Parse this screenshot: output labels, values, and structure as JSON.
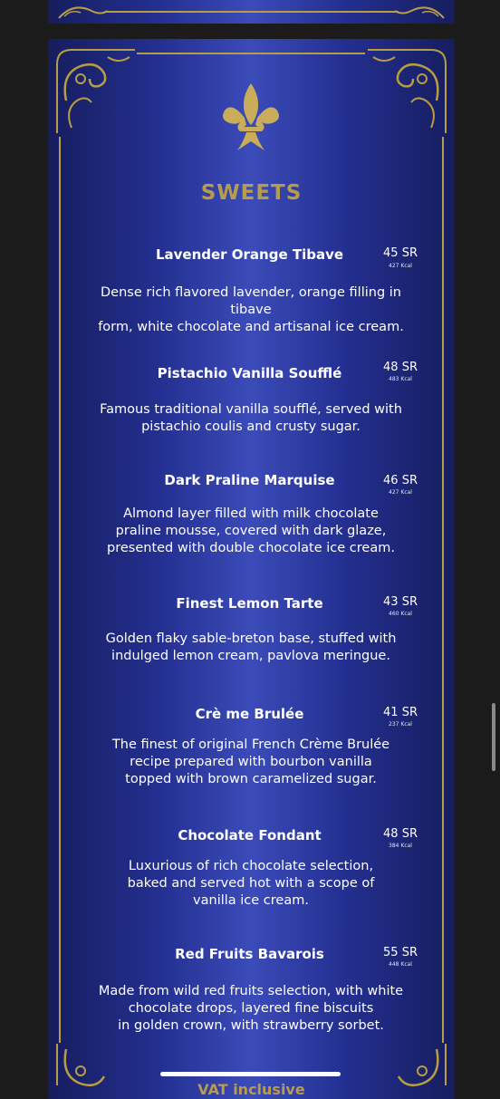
{
  "menu": {
    "section_title": "SWEETS",
    "items": [
      {
        "name": "Lavender Orange Tibave",
        "price": "45 SR",
        "kcal": "427 Kcal",
        "desc": [
          "Dense rich flavored lavender, orange filling in tibave",
          "form, white chocolate and artisanal ice cream."
        ]
      },
      {
        "name": "Pistachio Vanilla Soufflé",
        "price": "48 SR",
        "kcal": "483 Kcal",
        "desc": [
          "Famous traditional vanilla soufflé, served with",
          "pistachio coulis and crusty sugar."
        ]
      },
      {
        "name": "Dark Praline Marquise",
        "price": "46 SR",
        "kcal": "427 Kcal",
        "desc": [
          "Almond layer filled with milk chocolate",
          "praline mousse, covered with dark glaze,",
          "presented with double chocolate ice cream."
        ]
      },
      {
        "name": "Finest Lemon Tarte",
        "price": "43 SR",
        "kcal": "460 Kcal",
        "desc": [
          "Golden flaky sable-breton base, stuffed with",
          "indulged lemon cream, pavlova meringue."
        ]
      },
      {
        "name": "Crè me Brulée",
        "price": "41 SR",
        "kcal": "237 Kcal",
        "desc": [
          "The finest of original French Crème Brulée",
          "recipe prepared with bourbon vanilla",
          "topped with brown caramelized sugar."
        ]
      },
      {
        "name": "Chocolate Fondant",
        "price": "48 SR",
        "kcal": "384 Kcal",
        "desc": [
          "Luxurious of rich chocolate selection,",
          "baked and served hot with a scope of",
          "vanilla ice cream."
        ]
      },
      {
        "name": "Red Fruits Bavarois",
        "price": "55 SR",
        "kcal": "448 Kcal",
        "desc": [
          "Made from wild red fruits selection, with white",
          "chocolate drops, layered fine biscuits",
          "in golden crown, with strawberry sorbet."
        ]
      }
    ],
    "footer_text": "VAT inclusive"
  },
  "colors": {
    "gold": "#b79d4b",
    "panel_blue": "#243092",
    "background": "#1b1b1b"
  },
  "icons": [
    "fleur-de-lis-icon",
    "ornament-corner-icon"
  ]
}
